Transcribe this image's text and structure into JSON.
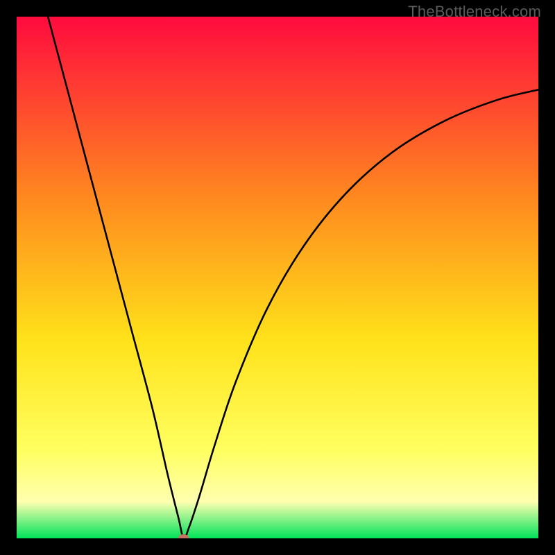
{
  "watermark": "TheBottleneck.com",
  "chart_data": {
    "type": "line",
    "title": "",
    "xlabel": "",
    "ylabel": "",
    "xlim": [
      0,
      100
    ],
    "ylim": [
      0,
      100
    ],
    "background_gradient": {
      "top": "#ff0b3e",
      "mid_upper": "#ff8a1f",
      "mid": "#ffe21a",
      "mid_lower": "#ffff60",
      "band": "#ffffb0",
      "bottom": "#00e35a"
    },
    "curve": [
      {
        "x": 6,
        "y": 100
      },
      {
        "x": 10,
        "y": 85
      },
      {
        "x": 14,
        "y": 70
      },
      {
        "x": 18,
        "y": 55
      },
      {
        "x": 22,
        "y": 40
      },
      {
        "x": 26,
        "y": 25
      },
      {
        "x": 29,
        "y": 12
      },
      {
        "x": 31,
        "y": 4
      },
      {
        "x": 32,
        "y": 0
      },
      {
        "x": 33,
        "y": 2
      },
      {
        "x": 35,
        "y": 8
      },
      {
        "x": 38,
        "y": 18
      },
      {
        "x": 42,
        "y": 30
      },
      {
        "x": 48,
        "y": 44
      },
      {
        "x": 55,
        "y": 56
      },
      {
        "x": 63,
        "y": 66
      },
      {
        "x": 72,
        "y": 74
      },
      {
        "x": 82,
        "y": 80
      },
      {
        "x": 92,
        "y": 84
      },
      {
        "x": 100,
        "y": 86
      }
    ],
    "marker": {
      "x": 32,
      "y": 0,
      "color": "#c57264"
    }
  }
}
